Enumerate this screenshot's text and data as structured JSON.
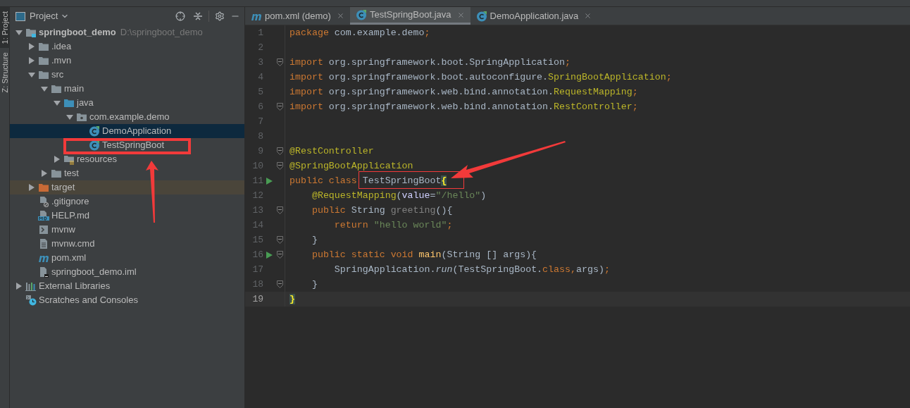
{
  "tool_windows": [
    {
      "label": "1: Project",
      "selected": true
    },
    {
      "label": "Z: Structure",
      "selected": false
    }
  ],
  "project_panel": {
    "title": "Project"
  },
  "tree": [
    {
      "name": "springboot_demo",
      "location": "D:\\springboot_demo",
      "kind": "project",
      "expanded": true,
      "selected": false,
      "children": [
        {
          "name": ".idea",
          "kind": "folder",
          "expanded": false,
          "selected": false
        },
        {
          "name": ".mvn",
          "kind": "folder",
          "expanded": false,
          "selected": false
        },
        {
          "name": "src",
          "kind": "folder",
          "expanded": true,
          "selected": false,
          "children": [
            {
              "name": "main",
              "kind": "folder",
              "expanded": true,
              "selected": false,
              "children": [
                {
                  "name": "java",
                  "kind": "source",
                  "expanded": true,
                  "selected": false,
                  "children": [
                    {
                      "name": "com.example.demo",
                      "kind": "package",
                      "expanded": true,
                      "selected": false,
                      "children": [
                        {
                          "name": "DemoApplication",
                          "kind": "class",
                          "selected": true
                        },
                        {
                          "name": "TestSpringBoot",
                          "kind": "class",
                          "selected": false,
                          "annotated": true
                        }
                      ]
                    }
                  ]
                },
                {
                  "name": "resources",
                  "kind": "resources",
                  "expanded": false,
                  "selected": false
                }
              ]
            },
            {
              "name": "test",
              "kind": "folder",
              "expanded": false,
              "selected": false
            }
          ]
        },
        {
          "name": "target",
          "kind": "excluded",
          "expanded": false,
          "selected": false
        },
        {
          "name": ".gitignore",
          "kind": "ignore",
          "selected": false
        },
        {
          "name": "HELP.md",
          "kind": "markdown",
          "selected": false
        },
        {
          "name": "mvnw",
          "kind": "shell",
          "selected": false
        },
        {
          "name": "mvnw.cmd",
          "kind": "text",
          "selected": false
        },
        {
          "name": "pom.xml",
          "kind": "maven",
          "selected": false
        },
        {
          "name": "springboot_demo.iml",
          "kind": "module",
          "selected": false
        }
      ]
    },
    {
      "name": "External Libraries",
      "kind": "libraries",
      "expanded": false,
      "selected": false
    },
    {
      "name": "Scratches and Consoles",
      "kind": "scratches",
      "selected": false
    }
  ],
  "tabs": [
    {
      "label": "pom.xml (demo)",
      "kind": "maven",
      "selected": false
    },
    {
      "label": "TestSpringBoot.java",
      "kind": "class",
      "selected": true
    },
    {
      "label": "DemoApplication.java",
      "kind": "class",
      "selected": false
    }
  ],
  "code": [
    {
      "number": "1",
      "run": false,
      "fold": false,
      "current": false,
      "tokens": [
        {
          "text": "package",
          "kind": "keyword"
        },
        {
          "text": " com.example.demo",
          "kind": "plain"
        },
        {
          "text": ";",
          "kind": "keyword"
        }
      ]
    },
    {
      "number": "2",
      "run": false,
      "fold": false,
      "current": false
    },
    {
      "number": "3",
      "run": false,
      "fold": true,
      "current": false,
      "tokens": [
        {
          "text": "import",
          "kind": "keyword"
        },
        {
          "text": " org.springframework.boot.SpringApplication",
          "kind": "plain"
        },
        {
          "text": ";",
          "kind": "keyword"
        }
      ]
    },
    {
      "number": "4",
      "run": false,
      "fold": false,
      "current": false,
      "tokens": [
        {
          "text": "import",
          "kind": "keyword"
        },
        {
          "text": " org.springframework.boot.autoconfigure.",
          "kind": "plain"
        },
        {
          "text": "SpringBootApplication",
          "kind": "annotation"
        },
        {
          "text": ";",
          "kind": "keyword"
        }
      ]
    },
    {
      "number": "5",
      "run": false,
      "fold": false,
      "current": false,
      "tokens": [
        {
          "text": "import",
          "kind": "keyword"
        },
        {
          "text": " org.springframework.web.bind.annotation.",
          "kind": "plain"
        },
        {
          "text": "RequestMapping",
          "kind": "annotation"
        },
        {
          "text": ";",
          "kind": "keyword"
        }
      ]
    },
    {
      "number": "6",
      "run": false,
      "fold": true,
      "current": false,
      "tokens": [
        {
          "text": "import",
          "kind": "keyword"
        },
        {
          "text": " org.springframework.web.bind.annotation.",
          "kind": "plain"
        },
        {
          "text": "RestController",
          "kind": "annotation"
        },
        {
          "text": ";",
          "kind": "keyword"
        }
      ]
    },
    {
      "number": "7",
      "run": false,
      "fold": false,
      "current": false
    },
    {
      "number": "8",
      "run": false,
      "fold": false,
      "current": false
    },
    {
      "number": "9",
      "run": false,
      "fold": true,
      "current": false,
      "tokens": [
        {
          "text": "@RestController",
          "kind": "annotation"
        }
      ]
    },
    {
      "number": "10",
      "run": false,
      "fold": true,
      "current": false,
      "tokens": [
        {
          "text": "@SpringBootApplication",
          "kind": "annotation"
        }
      ]
    },
    {
      "number": "11",
      "run": true,
      "fold": false,
      "current": false,
      "tokens": [
        {
          "text": "public class",
          "kind": "keyword"
        },
        {
          "text": " TestSpringBoot",
          "kind": "plain"
        },
        {
          "text": "{",
          "kind": "brace"
        }
      ]
    },
    {
      "number": "12",
      "run": false,
      "fold": false,
      "current": false,
      "tokens": [
        {
          "text": "    @RequestMapping",
          "kind": "annotation"
        },
        {
          "text": "(",
          "kind": "plain"
        },
        {
          "text": "value",
          "kind": "parameter"
        },
        {
          "text": "=",
          "kind": "plain"
        },
        {
          "text": "\"/hello\"",
          "kind": "string"
        },
        {
          "text": ")",
          "kind": "plain"
        }
      ]
    },
    {
      "number": "13",
      "run": false,
      "fold": true,
      "current": false,
      "tokens": [
        {
          "text": "    public",
          "kind": "keyword"
        },
        {
          "text": " String ",
          "kind": "plain"
        },
        {
          "text": "greeting",
          "kind": "unused"
        },
        {
          "text": "(){",
          "kind": "plain"
        }
      ]
    },
    {
      "number": "14",
      "run": false,
      "fold": false,
      "current": false,
      "tokens": [
        {
          "text": "        return ",
          "kind": "keyword"
        },
        {
          "text": "\"hello world\"",
          "kind": "string"
        },
        {
          "text": ";",
          "kind": "keyword"
        }
      ]
    },
    {
      "number": "15",
      "run": false,
      "fold": true,
      "current": false,
      "tokens": [
        {
          "text": "    }",
          "kind": "plain"
        }
      ]
    },
    {
      "number": "16",
      "run": true,
      "fold": true,
      "current": false,
      "tokens": [
        {
          "text": "    public static void ",
          "kind": "keyword"
        },
        {
          "text": "main",
          "kind": "method"
        },
        {
          "text": "(String [] args){",
          "kind": "plain"
        }
      ]
    },
    {
      "number": "17",
      "run": false,
      "fold": false,
      "current": false,
      "tokens": [
        {
          "text": "        SpringApplication.",
          "kind": "plain"
        },
        {
          "text": "run",
          "kind": "static"
        },
        {
          "text": "(TestSpringBoot.",
          "kind": "plain"
        },
        {
          "text": "class,",
          "kind": "keyword"
        },
        {
          "text": "args)",
          "kind": "plain"
        },
        {
          "text": ";",
          "kind": "keyword"
        }
      ]
    },
    {
      "number": "18",
      "run": false,
      "fold": true,
      "current": false,
      "tokens": [
        {
          "text": "    }",
          "kind": "plain"
        }
      ]
    },
    {
      "number": "19",
      "run": false,
      "fold": false,
      "current": true,
      "tokens": [
        {
          "text": "}",
          "kind": "brace"
        }
      ]
    }
  ]
}
